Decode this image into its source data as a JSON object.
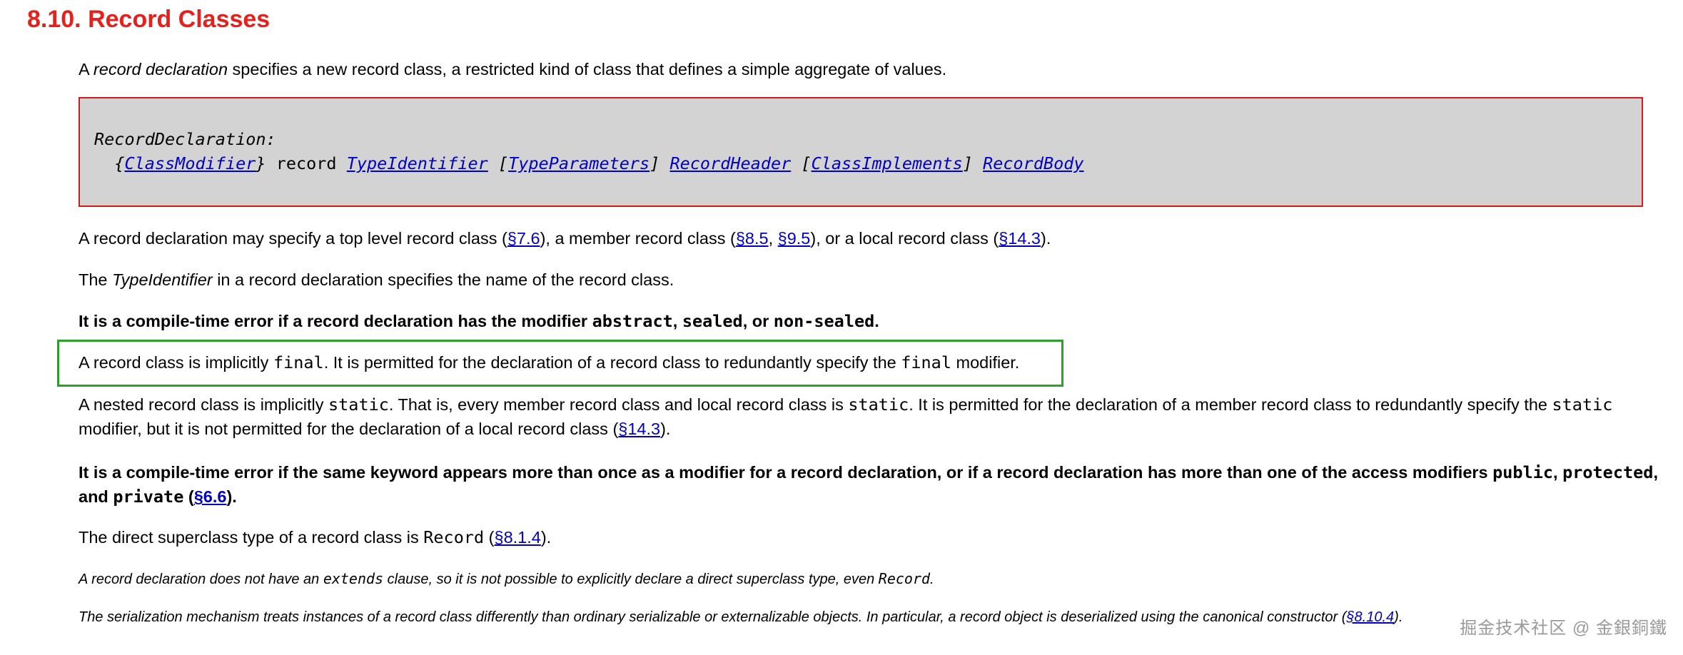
{
  "heading": "8.10. Record Classes",
  "intro": {
    "pre": "A ",
    "term": "record declaration",
    "post": " specifies a new record class, a restricted kind of class that defines a simple aggregate of values."
  },
  "grammar": {
    "lhs": "RecordDeclaration:",
    "open1": "{",
    "class_modifier": "ClassModifier",
    "close1": "}",
    "keyword": " record ",
    "type_identifier": "TypeIdentifier",
    "open2": " [",
    "type_parameters": "TypeParameters",
    "close2": "] ",
    "record_header": "RecordHeader",
    "open3": " [",
    "class_implements": "ClassImplements",
    "close3": "] ",
    "record_body": "RecordBody"
  },
  "p1": {
    "t1": "A record declaration may specify a top level record class (",
    "l1": "§7.6",
    "t2": "), a member record class (",
    "l2": "§8.5",
    "t3": ", ",
    "l3": "§9.5",
    "t4": "), or a local record class (",
    "l4": "§14.3",
    "t5": ")."
  },
  "p2": {
    "t1": "The ",
    "term": "TypeIdentifier",
    "t2": " in a record declaration specifies the name of the record class."
  },
  "p3": {
    "t1": "It is a compile-time error if a record declaration has the modifier ",
    "c1": "abstract",
    "t2": ", ",
    "c2": "sealed",
    "t3": ", or ",
    "c3": "non-sealed",
    "t4": "."
  },
  "p4": {
    "t1": "A record class is implicitly ",
    "c1": "final",
    "t2": ". It is permitted for the declaration of a record class to redundantly specify the ",
    "c2": "final",
    "t3": " modifier."
  },
  "p5": {
    "t1": "A nested record class is implicitly ",
    "c1": "static",
    "t2": ". That is, every member record class and local record class is ",
    "c2": "static",
    "t3": ". It is permitted for the declaration of a member record class to redundantly specify the ",
    "c3": "static",
    "t4": " modifier, but it is not permitted for the declaration of a local record class (",
    "l1": "§14.3",
    "t5": ")."
  },
  "p6": {
    "t1": "It is a compile-time error if the same keyword appears more than once as a modifier for a record declaration, or if a record declaration has more than one of the access modifiers ",
    "c1": "public",
    "t2": ", ",
    "c2": "protected",
    "t3": ", and ",
    "c3": "private",
    "t4": " (",
    "l1": "§6.6",
    "t5": ")."
  },
  "p7": {
    "t1": "The direct superclass type of a record class is ",
    "c1": "Record",
    "t2": " (",
    "l1": "§8.1.4",
    "t3": ")."
  },
  "note1": {
    "t1": "A record declaration does not have an ",
    "c1": "extends",
    "t2": " clause, so it is not possible to explicitly declare a direct superclass type, even ",
    "c2": "Record",
    "t3": "."
  },
  "note2": {
    "t1": "The serialization mechanism treats instances of a record class differently than ordinary serializable or externalizable objects. In particular, a record object is deserialized using the canonical constructor (",
    "l1": "§8.10.4",
    "t2": ")."
  },
  "watermark": "掘金技术社区 @ 金銀銅鐵",
  "colors": {
    "heading": "#e8201c",
    "link": "#0000cc",
    "grammar_bg": "#d3d3d3",
    "grammar_border": "#d11a1a",
    "highlight_border": "#2aa22a"
  }
}
